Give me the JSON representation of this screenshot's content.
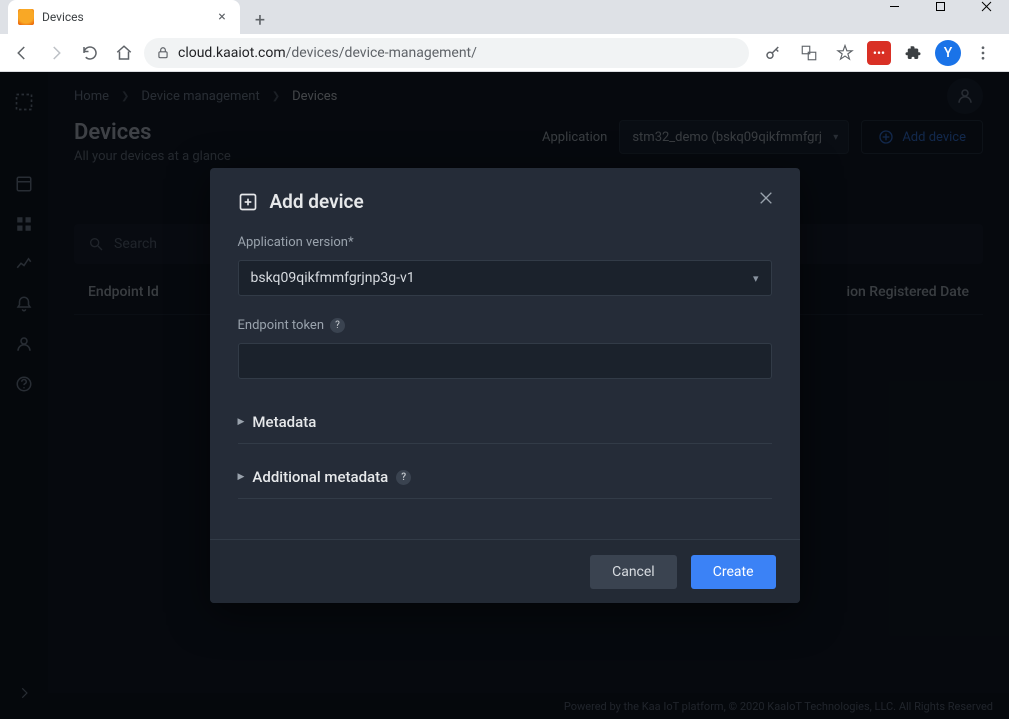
{
  "browser": {
    "tab_title": "Devices",
    "url_prefix": "cloud.kaaiot.com",
    "url_path": "/devices/device-management/",
    "avatar_initial": "Y"
  },
  "breadcrumb": {
    "items": [
      "Home",
      "Device management",
      "Devices"
    ]
  },
  "page_header": {
    "title": "Devices",
    "subtitle": "All your devices at a glance",
    "application_label": "Application",
    "application_selected": "stm32_demo (bskq09qikfmmfgrj",
    "add_device_label": "Add device"
  },
  "search": {
    "placeholder": "Search"
  },
  "table": {
    "col_endpoint": "Endpoint Id",
    "col_date": "ion Registered Date"
  },
  "modal": {
    "title": "Add device",
    "app_version_label": "Application version*",
    "app_version_value": "bskq09qikfmmfgrjnp3g-v1",
    "endpoint_token_label": "Endpoint token",
    "endpoint_token_value": "",
    "metadata_label": "Metadata",
    "additional_metadata_label": "Additional metadata",
    "cancel_label": "Cancel",
    "create_label": "Create"
  },
  "footer": {
    "text": "Powered by the Kaa IoT platform, © 2020 KaaIoT Technologies, LLC. All Rights Reserved"
  }
}
